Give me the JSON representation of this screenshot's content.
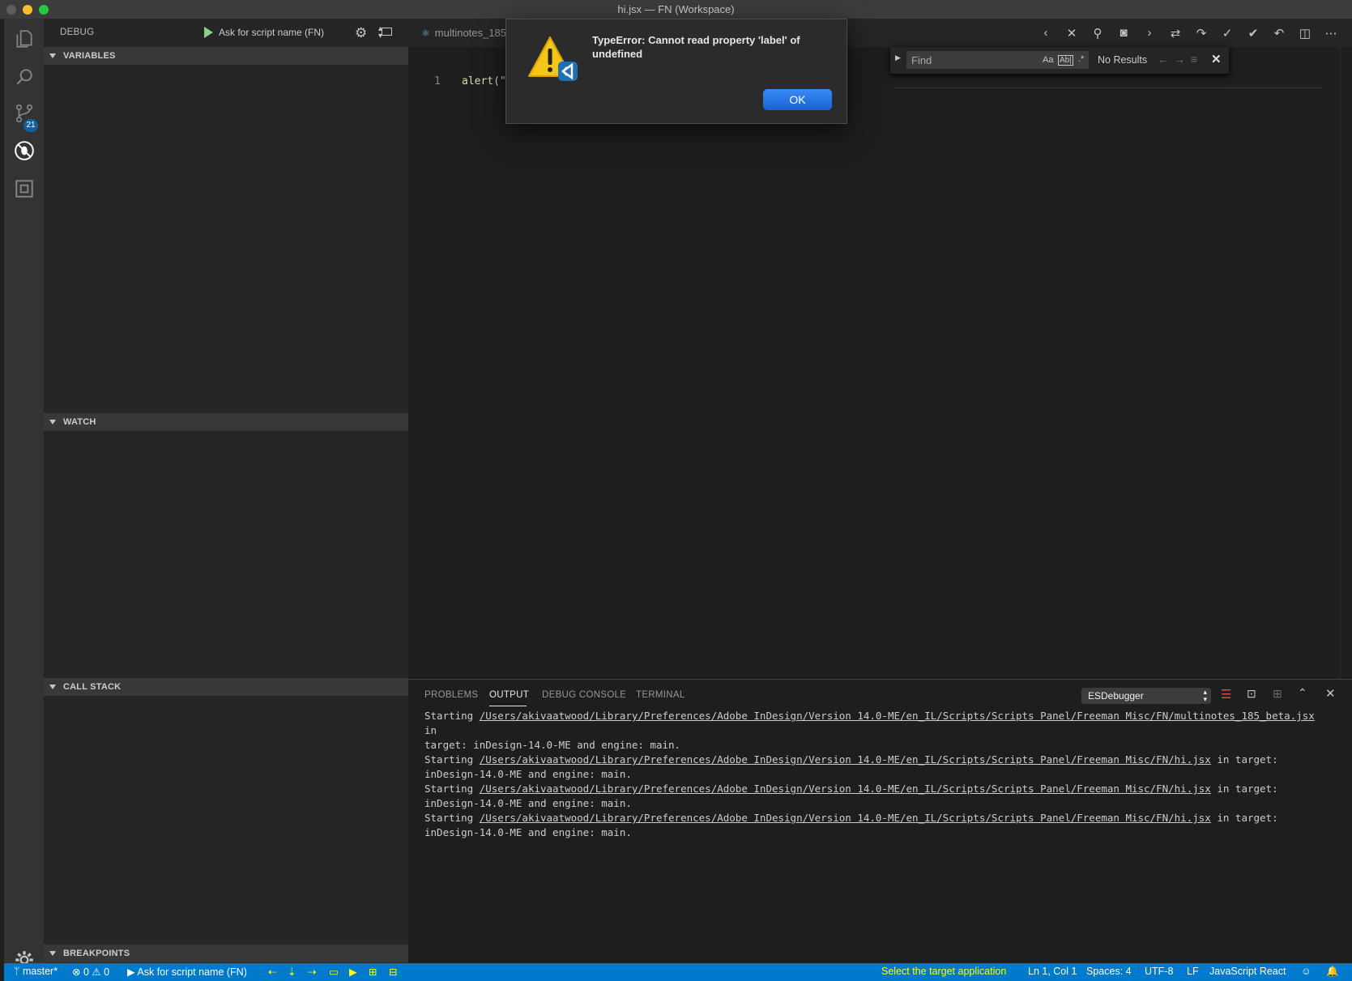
{
  "window": {
    "title": "hi.jsx — FN (Workspace)"
  },
  "activity_bar": {
    "scm_badge": "21"
  },
  "sidebar": {
    "debug_label": "DEBUG",
    "launch_config": "Ask for script name (FN)",
    "sections": {
      "variables": "VARIABLES",
      "watch": "WATCH",
      "call_stack": "CALL STACK",
      "breakpoints": "BREAKPOINTS"
    }
  },
  "editor": {
    "tab_label": "multinotes_185",
    "line_number": "1",
    "code": "alert(\"",
    "find": {
      "placeholder": "Find",
      "case": "Aa",
      "word": "Ab|",
      "regex": ".*",
      "result": "No Results"
    }
  },
  "dialog": {
    "message": "TypeError: Cannot read property 'label' of undefined",
    "ok_label": "OK"
  },
  "panel": {
    "tabs": [
      "PROBLEMS",
      "OUTPUT",
      "DEBUG CONSOLE",
      "TERMINAL"
    ],
    "active_tab": "OUTPUT",
    "output_channel": "ESDebugger",
    "lines": [
      {
        "pre": "Starting ",
        "path": "/Users/akivaatwood/Library/Preferences/Adobe InDesign/Version 14.0-ME/en_IL/Scripts/Scripts Panel/Freeman Misc/FN/multinotes_185_beta.jsx",
        "post": " in",
        "next": "target: inDesign-14.0-ME and engine: main."
      },
      {
        "pre": "Starting ",
        "path": "/Users/akivaatwood/Library/Preferences/Adobe InDesign/Version 14.0-ME/en_IL/Scripts/Scripts Panel/Freeman Misc/FN/hi.jsx",
        "post": " in target:",
        "next": "inDesign-14.0-ME and engine: main."
      },
      {
        "pre": "Starting ",
        "path": "/Users/akivaatwood/Library/Preferences/Adobe InDesign/Version 14.0-ME/en_IL/Scripts/Scripts Panel/Freeman Misc/FN/hi.jsx",
        "post": " in target:",
        "next": "inDesign-14.0-ME and engine: main."
      },
      {
        "pre": "Starting ",
        "path": "/Users/akivaatwood/Library/Preferences/Adobe InDesign/Version 14.0-ME/en_IL/Scripts/Scripts Panel/Freeman Misc/FN/hi.jsx",
        "post": " in target:",
        "next": "inDesign-14.0-ME and engine: main."
      }
    ]
  },
  "statusbar": {
    "branch": "master*",
    "errors": "0",
    "warnings": "0",
    "debug_config": "Ask for script name (FN)",
    "target_app": "Select the target application",
    "position": "Ln 1, Col 1",
    "spaces": "Spaces: 4",
    "encoding": "UTF-8",
    "eol": "LF",
    "language": "JavaScript React"
  },
  "colors": {
    "statusbar": "#007acc",
    "accent_yellow": "#ffff00",
    "dialog_button": "#1762d4"
  }
}
